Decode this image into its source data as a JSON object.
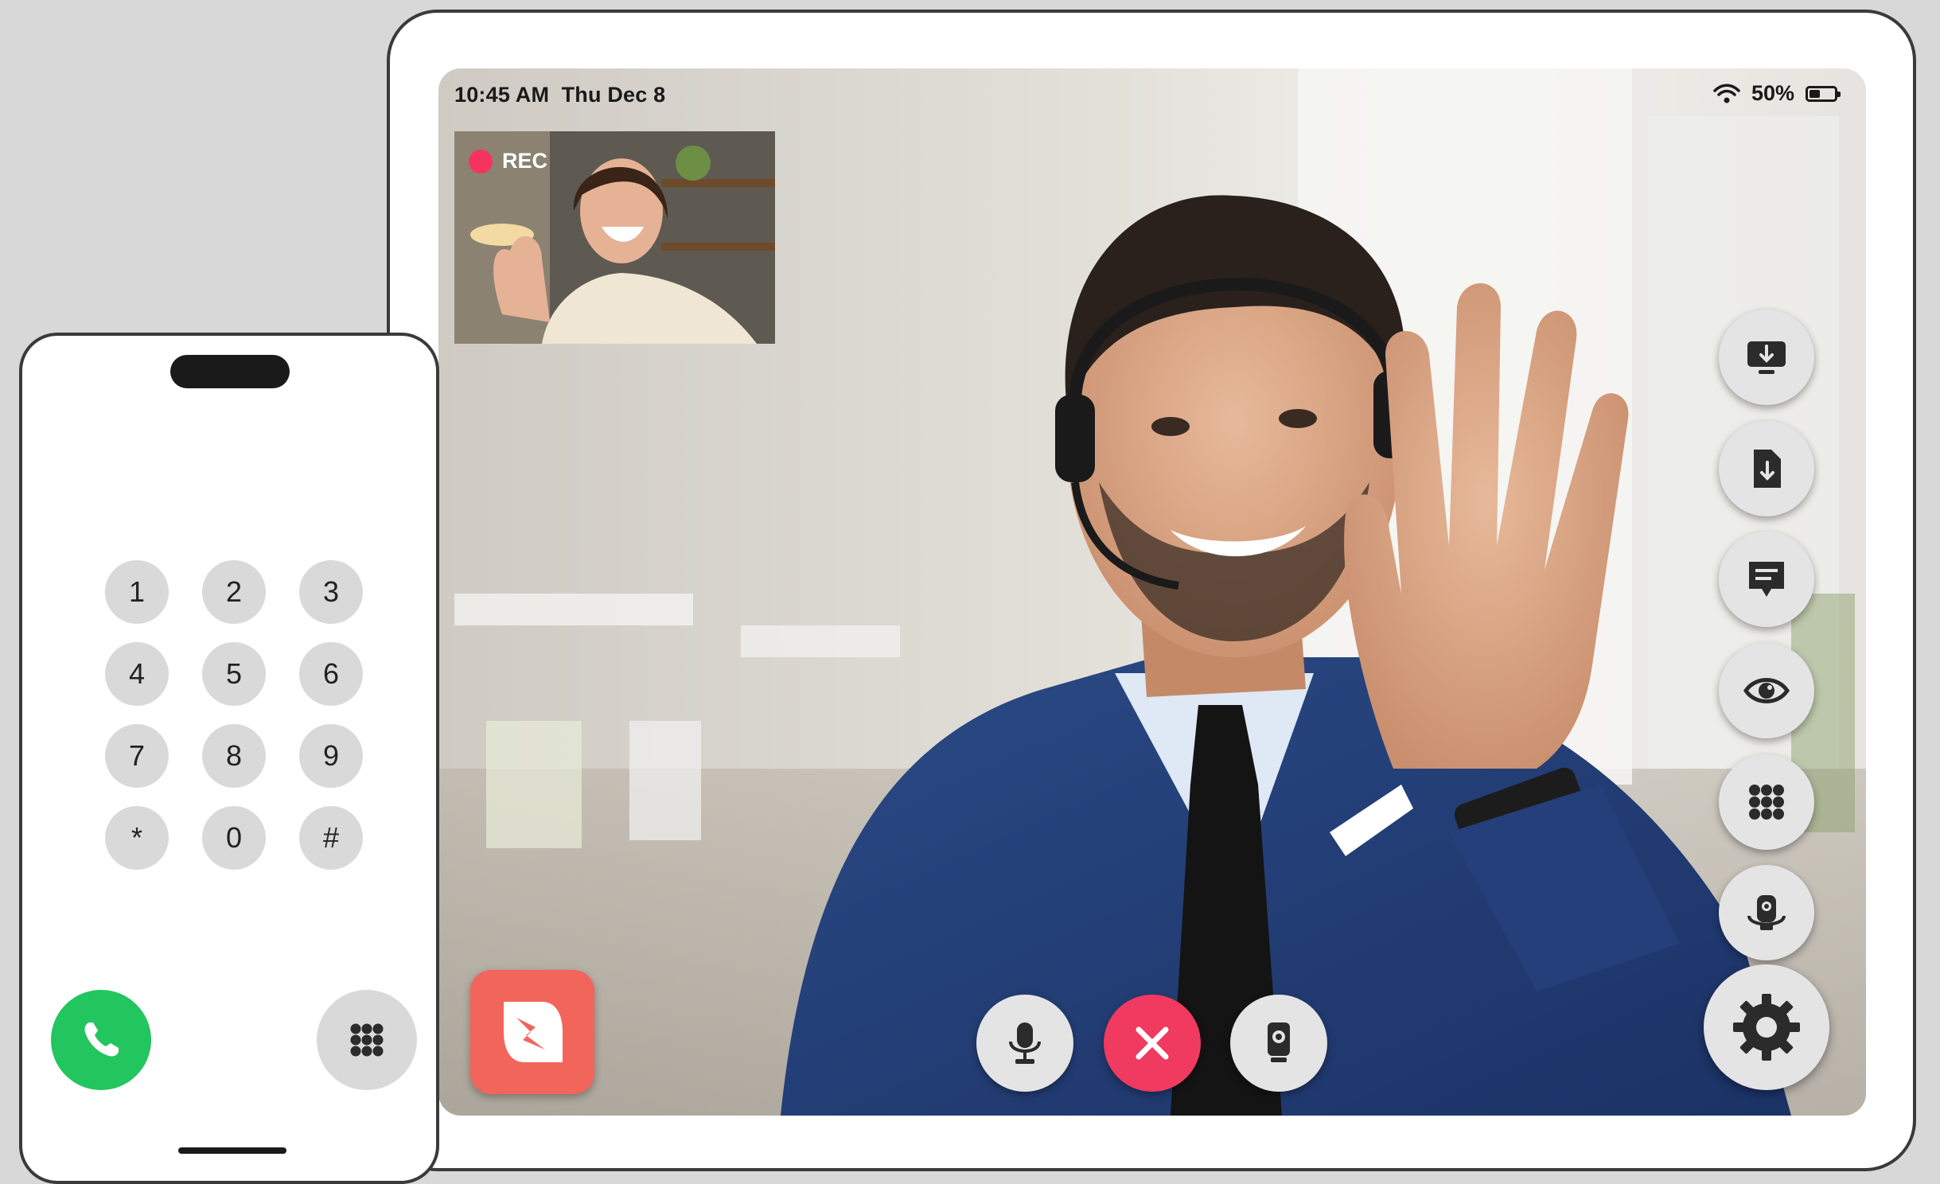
{
  "status_bar": {
    "time": "10:45 AM",
    "date": "Thu Dec 8",
    "battery": "50%",
    "battery_level": 0.5
  },
  "self_view": {
    "rec_label": "REC"
  },
  "side_controls": [
    {
      "name": "screen-share-icon"
    },
    {
      "name": "file-download-icon"
    },
    {
      "name": "chat-icon"
    },
    {
      "name": "eye-icon"
    },
    {
      "name": "keypad-icon"
    },
    {
      "name": "camera-switch-icon"
    }
  ],
  "bottom_controls": [
    {
      "name": "microphone-icon"
    },
    {
      "name": "close-icon"
    },
    {
      "name": "webcam-icon"
    }
  ],
  "dialpad": {
    "keys": [
      "1",
      "2",
      "3",
      "4",
      "5",
      "6",
      "7",
      "8",
      "9",
      "*",
      "0",
      "#"
    ]
  },
  "colors": {
    "hangup": "#f03a5f",
    "call": "#22c55e",
    "rec_dot": "#f5345d",
    "app_logo": "#f2655b",
    "button_bg": "#e4e4e4",
    "icon": "#2b2b2b"
  }
}
